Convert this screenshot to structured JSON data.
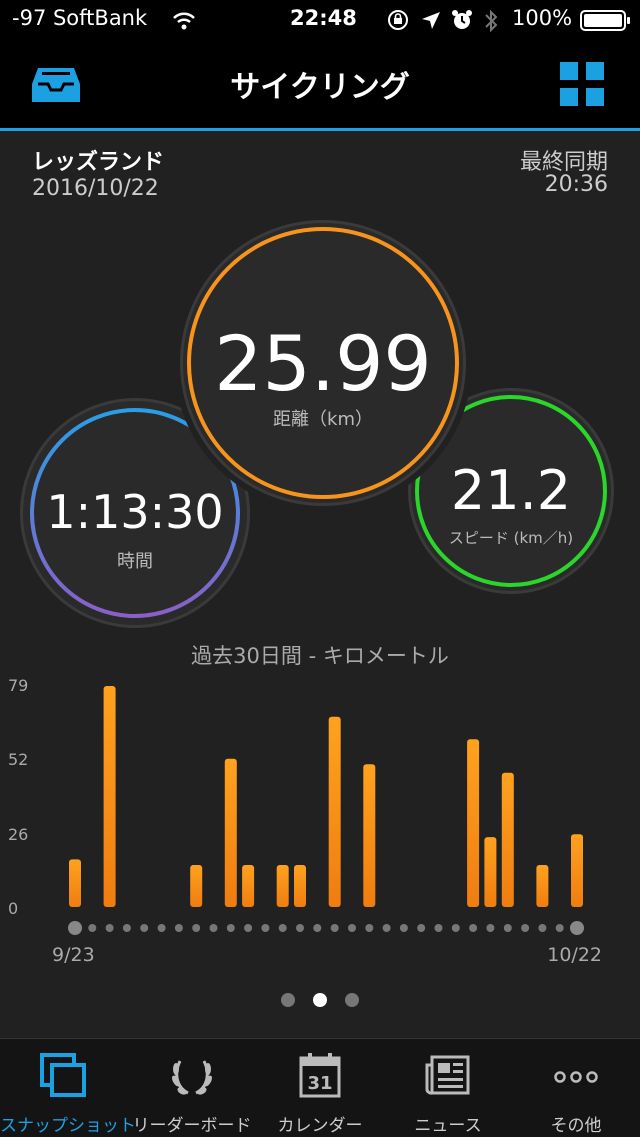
{
  "status_bar": {
    "carrier": "-97 SoftBank",
    "time": "22:48",
    "battery": "100%",
    "icons": [
      "wifi-icon",
      "orientation-lock-icon",
      "location-icon",
      "alarm-icon",
      "bluetooth-icon",
      "battery-icon"
    ]
  },
  "nav": {
    "title": "サイクリング",
    "left_icon": "inbox-tray-icon",
    "right_icon": "grid-icon",
    "accent": "#1ba0e2"
  },
  "activity": {
    "name": "レッズランド",
    "date": "2016/10/22",
    "sync_label": "最終同期",
    "sync_time": "20:36"
  },
  "stats": {
    "distance": {
      "value": "25.99",
      "label": "距離（km）",
      "color": "#f7941d"
    },
    "time": {
      "value": "1:13:30",
      "label": "時間"
    },
    "speed": {
      "value": "21.2",
      "label": "スピード (km／h)",
      "color": "#2bd62b"
    }
  },
  "chart_data": {
    "type": "bar",
    "title": "過去30日間 - キロメートル",
    "yticks": [
      "79",
      "52",
      "26",
      "0"
    ],
    "ylim": [
      0,
      79
    ],
    "x_start_label": "9/23",
    "x_end_label": "10/22",
    "bar_color": "#f7941d",
    "categories": [
      "9/23",
      "9/24",
      "9/25",
      "9/26",
      "9/27",
      "9/28",
      "9/29",
      "9/30",
      "10/1",
      "10/2",
      "10/3",
      "10/4",
      "10/5",
      "10/6",
      "10/7",
      "10/8",
      "10/9",
      "10/10",
      "10/11",
      "10/12",
      "10/13",
      "10/14",
      "10/15",
      "10/16",
      "10/17",
      "10/18",
      "10/19",
      "10/20",
      "10/21",
      "10/22"
    ],
    "values": [
      17,
      0,
      79,
      0,
      0,
      0,
      0,
      15,
      0,
      53,
      15,
      0,
      15,
      15,
      0,
      68,
      0,
      51,
      0,
      0,
      0,
      0,
      0,
      60,
      25,
      48,
      0,
      15,
      0,
      26
    ]
  },
  "pager": {
    "count": 3,
    "active": 1
  },
  "tabs": [
    {
      "label": "スナップショット",
      "icon": "snapshot-icon",
      "active": true
    },
    {
      "label": "リーダーボード",
      "icon": "laurel-icon",
      "active": false
    },
    {
      "label": "カレンダー",
      "icon": "calendar-icon",
      "day": "31",
      "active": false
    },
    {
      "label": "ニュース",
      "icon": "news-icon",
      "active": false
    },
    {
      "label": "その他",
      "icon": "more-icon",
      "active": false
    }
  ]
}
